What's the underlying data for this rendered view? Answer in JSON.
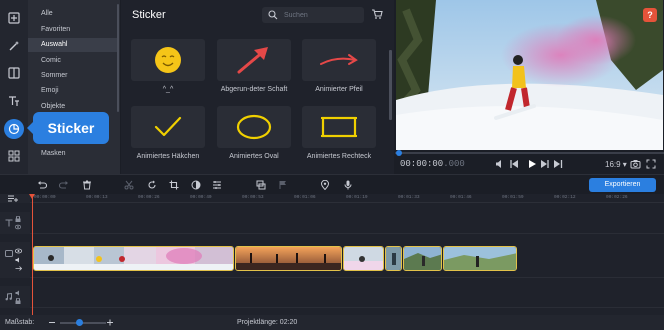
{
  "categories": {
    "items": [
      "Alle",
      "Favoriten",
      "Auswahl",
      "Comic",
      "Sommer",
      "Emoji",
      "Objekte",
      "Masken"
    ],
    "active": "Auswahl"
  },
  "tooltip": "Sticker",
  "panel": {
    "title": "Sticker",
    "search_placeholder": "Suchen",
    "stickers": [
      {
        "label": "^_^",
        "icon": "smiley-sticker"
      },
      {
        "label": "Abgerun-deter Schaft",
        "icon": "red-arrow-sticker"
      },
      {
        "label": "Animierter Pfeil",
        "icon": "curved-arrow-sticker"
      },
      {
        "label": "Animiertes Häkchen",
        "icon": "checkmark-sticker"
      },
      {
        "label": "Animiertes Oval",
        "icon": "oval-sticker"
      },
      {
        "label": "Animiertes Rechteck",
        "icon": "rectangle-sticker"
      }
    ]
  },
  "preview": {
    "help": "?",
    "timecode": "00:00:00",
    "timecode_ms": ".000",
    "aspect_ratio": "16:9 ▾",
    "progress_fraction": 0
  },
  "toolbar": {
    "export_label": "Exportieren"
  },
  "timeline": {
    "ruler": [
      "00:00:00",
      "00:00:13",
      "00:00:26",
      "00:00:40",
      "00:00:53",
      "00:01:06",
      "00:01:19",
      "00:01:33",
      "00:01:46",
      "00:01:59",
      "00:02:12",
      "00:02:26",
      "00:02:39",
      "00:02:52"
    ]
  },
  "status": {
    "scale_label": "Maßstab:",
    "project_length": "Projektlänge:  02:20"
  },
  "colors": {
    "accent": "#2b7fe0",
    "clip_border": "#e2c24a",
    "playhead": "#e5533a",
    "help_badge": "#e5533a"
  }
}
